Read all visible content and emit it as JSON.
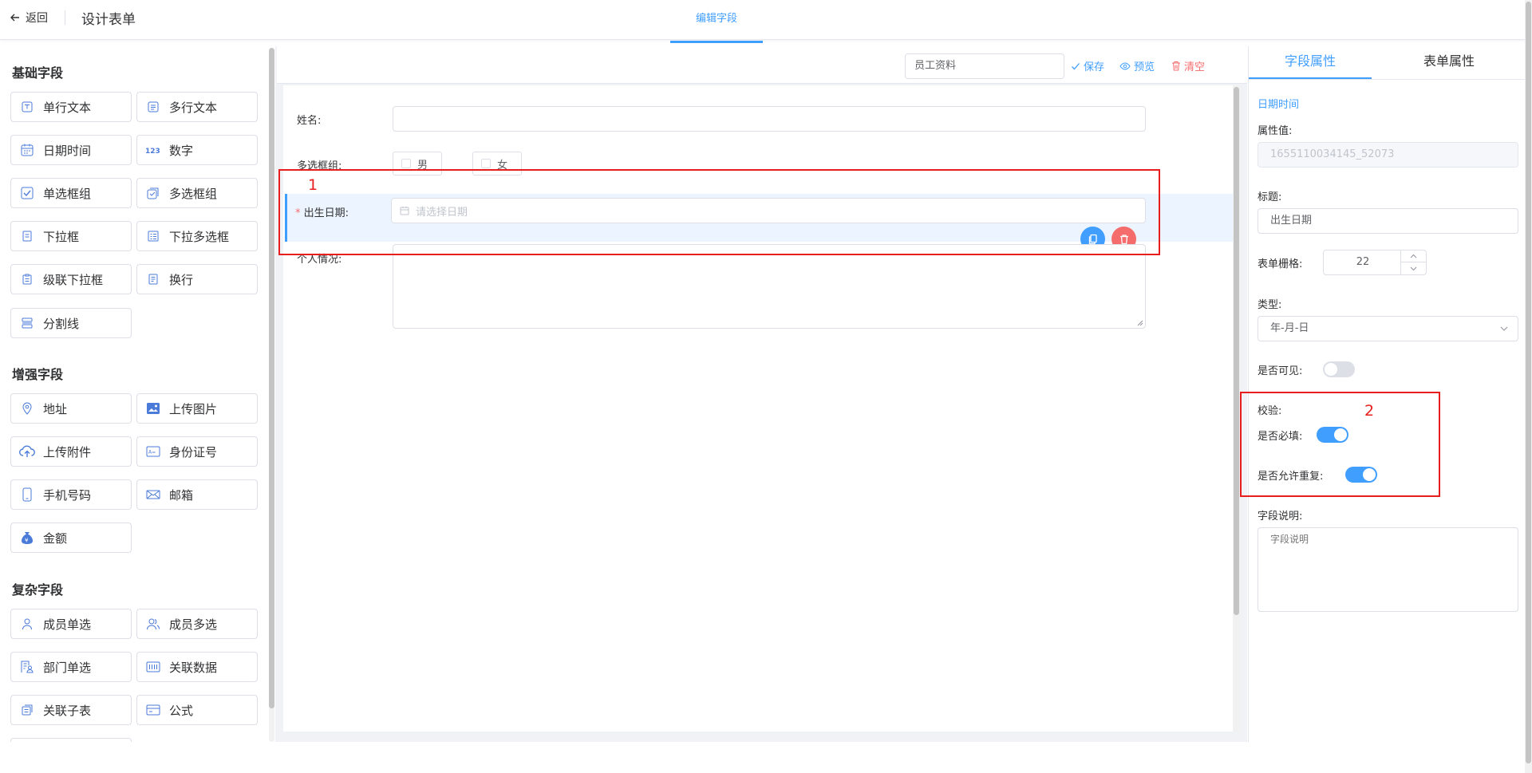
{
  "header": {
    "back_label": "返回",
    "page_title": "设计表单",
    "center_tab": "编辑字段"
  },
  "palette": {
    "groups": [
      {
        "title": "基础字段",
        "items": [
          {
            "label": "单行文本",
            "icon": "text-field-icon"
          },
          {
            "label": "多行文本",
            "icon": "textarea-icon"
          },
          {
            "label": "日期时间",
            "icon": "calendar-icon"
          },
          {
            "label": "数字",
            "icon": "number-icon"
          },
          {
            "label": "单选框组",
            "icon": "radio-icon"
          },
          {
            "label": "多选框组",
            "icon": "checkbox-icon"
          },
          {
            "label": "下拉框",
            "icon": "dropdown-icon"
          },
          {
            "label": "下拉多选框",
            "icon": "multi-dropdown-icon"
          },
          {
            "label": "级联下拉框",
            "icon": "cascade-icon"
          },
          {
            "label": "换行",
            "icon": "line-break-icon"
          },
          {
            "label": "分割线",
            "icon": "divider-icon"
          }
        ]
      },
      {
        "title": "增强字段",
        "items": [
          {
            "label": "地址",
            "icon": "location-icon"
          },
          {
            "label": "上传图片",
            "icon": "image-icon"
          },
          {
            "label": "上传附件",
            "icon": "upload-cloud-icon"
          },
          {
            "label": "身份证号",
            "icon": "id-card-icon"
          },
          {
            "label": "手机号码",
            "icon": "phone-icon"
          },
          {
            "label": "邮箱",
            "icon": "mail-icon"
          },
          {
            "label": "金额",
            "icon": "money-bag-icon"
          }
        ]
      },
      {
        "title": "复杂字段",
        "items": [
          {
            "label": "成员单选",
            "icon": "user-icon"
          },
          {
            "label": "成员多选",
            "icon": "users-icon"
          },
          {
            "label": "部门单选",
            "icon": "department-icon"
          },
          {
            "label": "关联数据",
            "icon": "linked-data-icon"
          },
          {
            "label": "关联子表",
            "icon": "subtable-icon"
          },
          {
            "label": "公式",
            "icon": "formula-icon"
          }
        ]
      }
    ]
  },
  "toolbar": {
    "form_name": "员工资料",
    "save_label": "保存",
    "preview_label": "预览",
    "clear_label": "清空"
  },
  "canvas": {
    "name_label": "姓名:",
    "checkbox_group_label": "多选框组:",
    "checkbox_options": [
      "男",
      "女"
    ],
    "birth_required_mark": "*",
    "birth_label": "出生日期:",
    "birth_placeholder": "请选择日期",
    "personal_label": "个人情况:"
  },
  "annotations": {
    "box1": "1",
    "box2": "2"
  },
  "properties": {
    "tabs": [
      "字段属性",
      "表单属性"
    ],
    "field_type": "日期时间",
    "attr_value_label": "属性值:",
    "attr_value": "1655110034145_52073",
    "title_label": "标题:",
    "title_value": "出生日期",
    "grid_label": "表单栅格:",
    "grid_value": "22",
    "type_label": "类型:",
    "type_value": "年-月-日",
    "visible_label": "是否可见:",
    "visible_on": false,
    "validation_label": "校验:",
    "required_label": "是否必填:",
    "required_on": true,
    "duplicate_label": "是否允许重复:",
    "duplicate_on": true,
    "desc_label": "字段说明:",
    "desc_placeholder": "字段说明"
  },
  "colors": {
    "primary": "#409eff",
    "danger": "#f56c6c",
    "annotation": "#e81e1e"
  }
}
